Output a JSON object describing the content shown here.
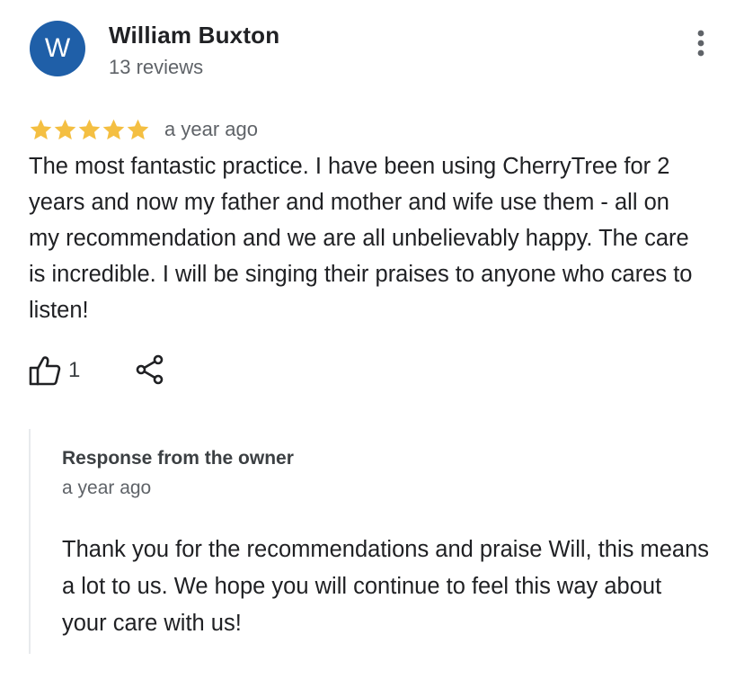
{
  "review": {
    "avatar_letter": "W",
    "avatar_color": "#1f5fa8",
    "reviewer_name": "William Buxton",
    "reviewer_review_count": "13 reviews",
    "rating": 5,
    "rating_max": 5,
    "star_color": "#f4bf42",
    "date": "a year ago",
    "text": "The most fantastic practice. I have been using CherryTree for 2 years and now my father and mother and wife use them - all on my recommendation and we are all unbelievably happy. The care is incredible. I will be singing their praises to anyone who cares to listen!",
    "like_count": "1",
    "icons": {
      "more": "more-vert-icon",
      "like": "thumbs-up-icon",
      "share": "share-icon",
      "star": "star-icon"
    }
  },
  "owner_response": {
    "title": "Response from the owner",
    "date": "a year ago",
    "text": "Thank you for the recommendations and praise Will, this means a lot to us. We hope you will continue to feel this way about your care with us!"
  }
}
